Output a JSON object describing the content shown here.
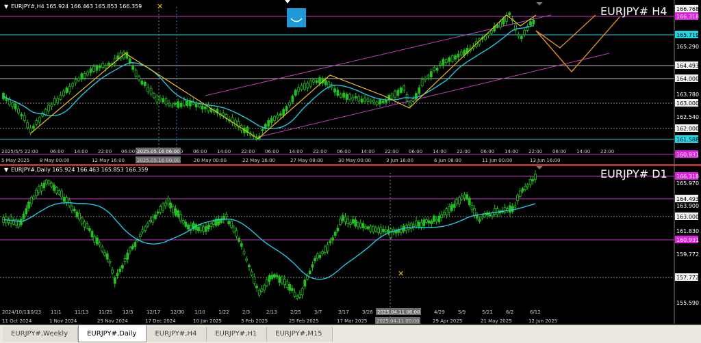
{
  "h4": {
    "info": "EURJPY#,H4  165.924 166.463 165.853 166.359",
    "big_label": "EURJPY# H4",
    "price_labels": [
      {
        "price": "166.768",
        "style": "white"
      },
      {
        "price": "166.318",
        "style": "magenta"
      },
      {
        "price": "165.719",
        "style": "cyan"
      },
      {
        "price": "165.290",
        "style": "plain"
      },
      {
        "price": "164.493",
        "style": "white"
      },
      {
        "price": "164.000",
        "style": "white"
      },
      {
        "price": "163.780",
        "style": "plain"
      },
      {
        "price": "163.000",
        "style": "white"
      },
      {
        "price": "162.540",
        "style": "plain"
      },
      {
        "price": "162.000",
        "style": "white"
      },
      {
        "price": "161.588",
        "style": "cyan"
      },
      {
        "price": "160.931",
        "style": "magenta"
      }
    ],
    "time_labels": [
      "2025/5/5 22:00",
      "06:00",
      "14:00",
      "22:00",
      "06:00",
      "14:00",
      "22:00",
      "06:00",
      "14:00",
      "22:00",
      "06:00",
      "14:00",
      "22:00",
      "06:00",
      "14:00",
      "22:00",
      "06:00",
      "14:00",
      "22:00",
      "06:00",
      "14:00",
      "22:00",
      "06:00",
      "14:00",
      "22:00"
    ],
    "crosshair_time": "2025.05.16 06:00",
    "date_labels": [
      "5 May 2025",
      "8 May 00:00",
      "12 May 16:00",
      "2025.05.16 00:00",
      "20 May 00:00",
      "22 May 16:00",
      "27 May 08:00",
      "30 May 00:00",
      "3 Jun 16:00",
      "6 Jun 08:00",
      "11 Jun 00:00",
      "13 Jun 16:00"
    ]
  },
  "d1": {
    "info": "EURJPY#,Daily  165.924 166.463 165.853 166.359",
    "big_label": "EURJPY# D1",
    "price_labels": [
      {
        "price": "166.318",
        "style": "magenta"
      },
      {
        "price": "165.970",
        "style": "plain"
      },
      {
        "price": "164.493",
        "style": "white"
      },
      {
        "price": "163.900",
        "style": "plain"
      },
      {
        "price": "163.000",
        "style": "white"
      },
      {
        "price": "161.830",
        "style": "plain"
      },
      {
        "price": "160.931",
        "style": "magenta"
      },
      {
        "price": "159.772",
        "style": "plain"
      },
      {
        "price": "157.772",
        "style": "white"
      },
      {
        "price": "155.590",
        "style": "plain"
      }
    ],
    "time_labels": [
      "2024/10/11",
      "10/23",
      "11/1",
      "11/13",
      "11/25",
      "12/5",
      "12/17",
      "12/30",
      "1/10",
      "1/22",
      "2/3",
      "2/13",
      "2/25",
      "3/7",
      "3/17",
      "3/26",
      "4/8",
      "4/29",
      "5/9",
      "5/21",
      "6/2",
      "6/12"
    ],
    "crosshair_time": "2025.04.11 06:00",
    "date_labels": [
      "11 Oct 2024",
      "1 Nov 2024",
      "25 Nov 2024",
      "17 Dec 2024",
      "10 Jan 2025",
      "3 Feb 2025",
      "25 Feb 2025",
      "17 Mar 2025",
      "2025.04.11 00:00",
      "29 Apr 2025",
      "21 May 2025",
      "12 Jun 2025"
    ]
  },
  "tabs": [
    "EURJPY#,Weekly",
    "EURJPY#,Daily",
    "EURJPY#,H4",
    "EURJPY#,H1",
    "EURJPY#,M15"
  ],
  "active_tab": 1,
  "colors": {
    "bull": "#22c01e",
    "ma": "#20c8e0",
    "zigzag": "#f0c020",
    "forecast": "#e08a20",
    "channel": "#c040c0",
    "hline": "#8a8a8a"
  }
}
